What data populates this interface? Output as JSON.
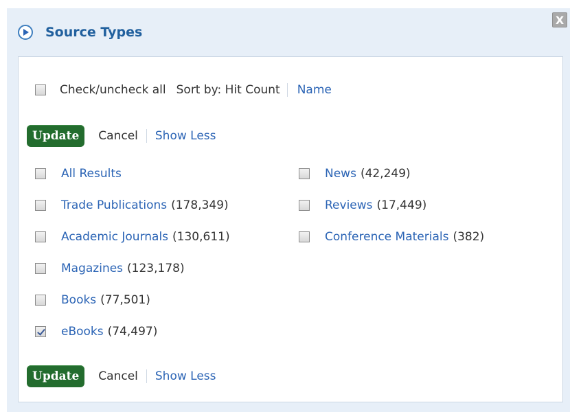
{
  "header": {
    "title": "Source Types",
    "close_icon_glyph": "X"
  },
  "controls": {
    "check_all_label": "Check/uncheck all",
    "sort_by_label": "Sort by: Hit Count",
    "sort_name_label": "Name"
  },
  "actions": {
    "update_label": "Update",
    "cancel_label": "Cancel",
    "show_less_label": "Show Less"
  },
  "left_column": [
    {
      "label": "All Results",
      "count": "",
      "checked": false
    },
    {
      "label": "Trade Publications",
      "count": "(178,349)",
      "checked": false
    },
    {
      "label": "Academic Journals",
      "count": "(130,611)",
      "checked": false
    },
    {
      "label": "Magazines",
      "count": "(123,178)",
      "checked": false
    },
    {
      "label": "Books",
      "count": "(77,501)",
      "checked": false
    },
    {
      "label": "eBooks",
      "count": "(74,497)",
      "checked": true
    }
  ],
  "right_column": [
    {
      "label": "News",
      "count": "(42,249)",
      "checked": false
    },
    {
      "label": "Reviews",
      "count": "(17,449)",
      "checked": false
    },
    {
      "label": "Conference Materials",
      "count": "(382)",
      "checked": false
    }
  ],
  "colors": {
    "title": "#21609e",
    "link": "#2b64b5",
    "update_bg": "#236c2e",
    "panel_bg": "#e7eff8"
  }
}
